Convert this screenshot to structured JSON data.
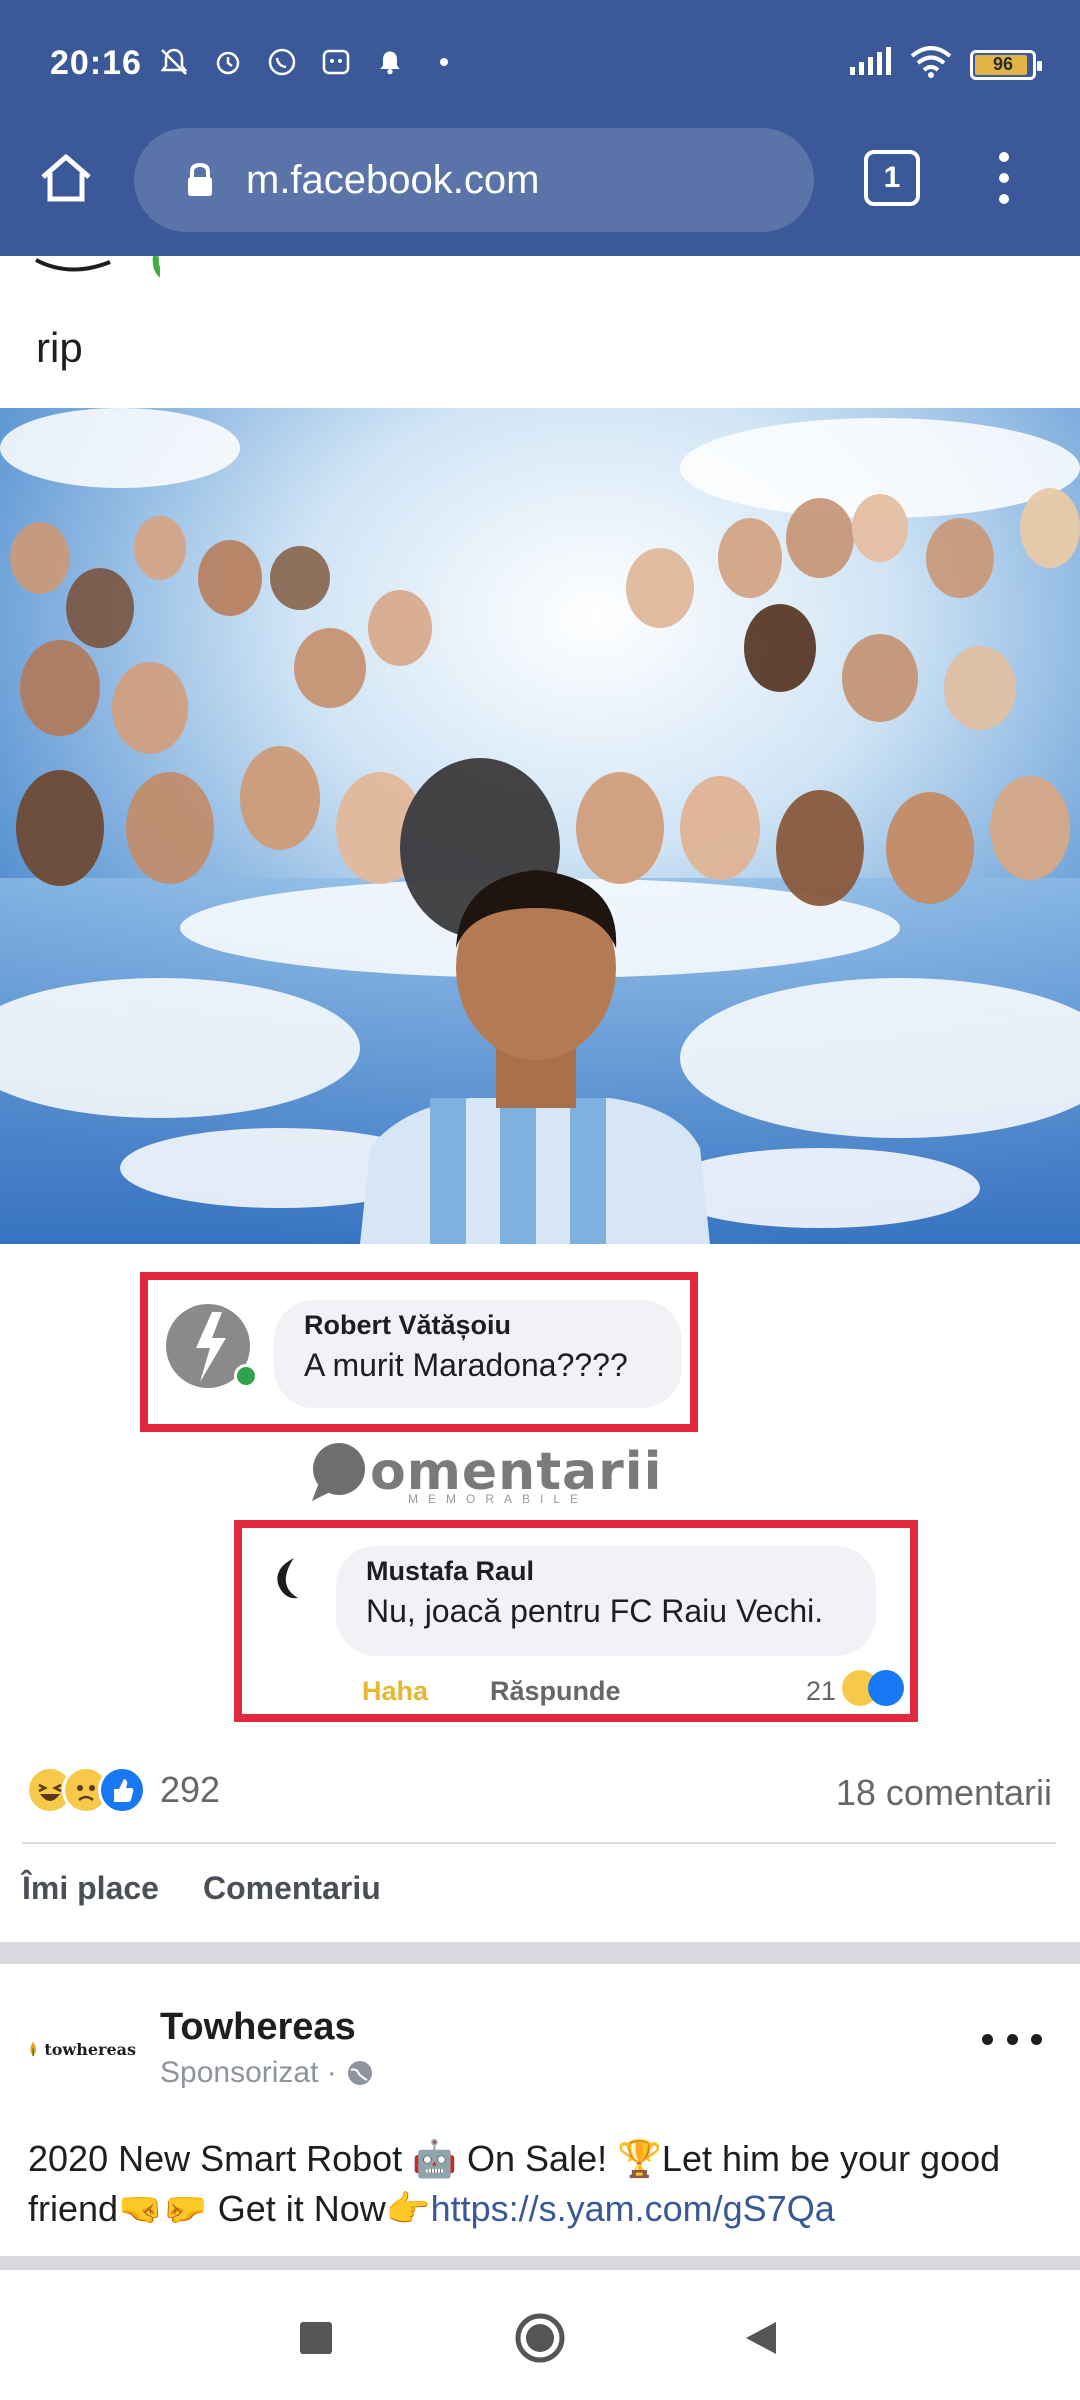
{
  "status_bar": {
    "time": "20:16",
    "battery": "96",
    "icons": [
      "muted-icon",
      "alarm-icon",
      "whatsapp-icon",
      "app-icon",
      "notification-bell-icon",
      "dot-icon"
    ],
    "right_icons": [
      "signal-icon",
      "wifi-icon",
      "battery-icon"
    ]
  },
  "browser": {
    "url": "m.facebook.com",
    "tab_count": "1"
  },
  "post": {
    "text": "rip",
    "comment_screenshot": {
      "comment1": {
        "name": "Robert Vătășoiu",
        "text": "A murit Maradona????"
      },
      "watermark": {
        "title": "omentarii",
        "subtitle": "MEMORABILE"
      },
      "comment2": {
        "name": "Mustafa Raul",
        "text": "Nu, joacă pentru FC Raiu Vechi.",
        "haha": "Haha",
        "reply": "Răspunde",
        "count": "21"
      }
    },
    "reaction_count": "292",
    "comment_count": "18 comentarii",
    "actions": {
      "like": "Îmi place",
      "comment": "Comentariu"
    }
  },
  "sponsored": {
    "page_name": "Towhereas",
    "label": "Sponsorizat ·",
    "logo_text": "towhereas",
    "body": "2020 New Smart Robot 🤖 On Sale! 🏆Let him be your good friend🤜🤛 Get it Now👉",
    "link": "https://s.yam.com/gS7Qa"
  },
  "colors": {
    "brand": "#3b5998",
    "highlight_red": "#e2283c",
    "haha_yellow": "#e8b730",
    "link": "#385898"
  }
}
